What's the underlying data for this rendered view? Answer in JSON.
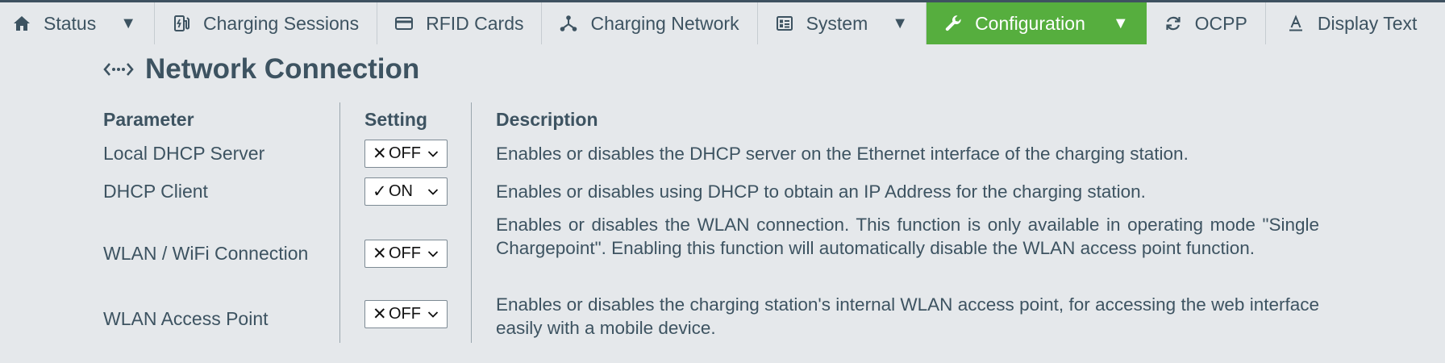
{
  "nav": {
    "items": [
      {
        "label": "Status",
        "icon": "home-icon",
        "caret": "▼"
      },
      {
        "label": "Charging Sessions",
        "icon": "charger-icon"
      },
      {
        "label": "RFID Cards",
        "icon": "card-icon"
      },
      {
        "label": "Charging Network",
        "icon": "network-icon"
      },
      {
        "label": "System",
        "icon": "system-icon",
        "caret": "▼"
      },
      {
        "label": "Configuration",
        "icon": "wrench-icon",
        "caret": "▼",
        "active": true
      },
      {
        "label": "OCPP",
        "icon": "sync-icon"
      },
      {
        "label": "Display Text",
        "icon": "text-icon"
      }
    ]
  },
  "page": {
    "title": "Network Connection",
    "icon": "network-connection-icon"
  },
  "table": {
    "headers": {
      "parameter": "Parameter",
      "setting": "Setting",
      "description": "Description"
    },
    "rows": [
      {
        "parameter": "Local DHCP Server",
        "setting": {
          "mark": "✕",
          "value": "OFF"
        },
        "description": "Enables or disables the DHCP server on the Ethernet interface of the charging station."
      },
      {
        "parameter": "DHCP Client",
        "setting": {
          "mark": "✓",
          "value": "ON"
        },
        "description": "Enables or disables using DHCP to obtain an IP Address for the charging station."
      },
      {
        "parameter": "WLAN / WiFi Connection",
        "setting": {
          "mark": "✕",
          "value": "OFF"
        },
        "description": "Enables or disables the WLAN connection. This function is only available in operating mode \"Single Chargepoint\". Enabling this function will automatically disable the WLAN access point function."
      },
      {
        "parameter": "WLAN Access Point",
        "setting": {
          "mark": "✕",
          "value": "OFF"
        },
        "description": "Enables or disables the charging station's internal WLAN access point, for accessing the web interface easily with a mobile device."
      }
    ]
  },
  "colors": {
    "background": "#e5e8eb",
    "text": "#3d5361",
    "active_tab": "#56ae3e",
    "top_border": "#3e5160"
  }
}
